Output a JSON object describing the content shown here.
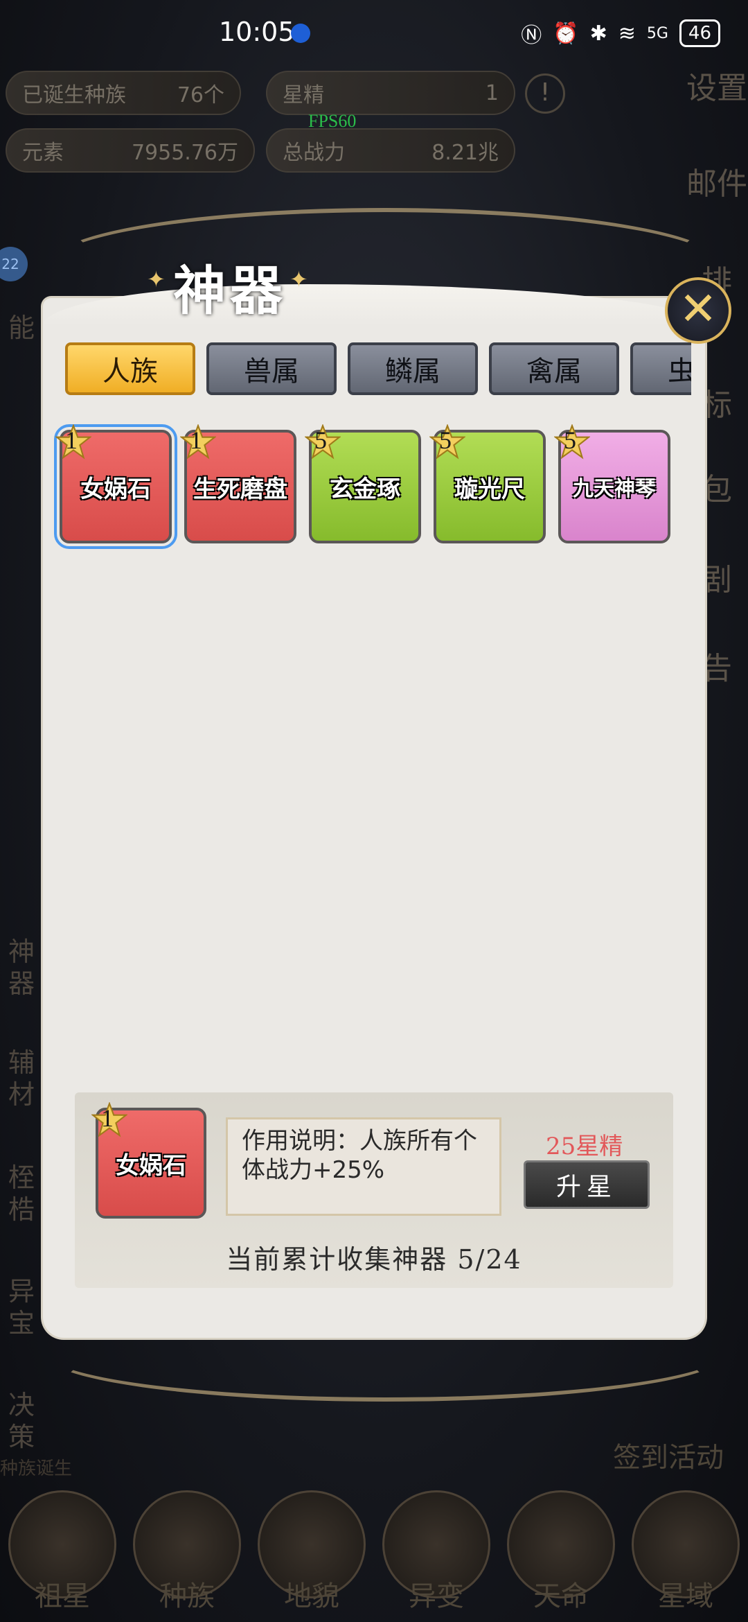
{
  "status_bar": {
    "time": "10:05",
    "battery": "46",
    "network": "5G"
  },
  "hud": {
    "races_born_label": "已诞生种族",
    "races_born_value": "76个",
    "star_essence_label": "星精",
    "star_essence_value": "1",
    "element_label": "元素",
    "element_value": "7955.76万",
    "power_label": "总战力",
    "power_value": "8.21兆",
    "fps": "FPS60"
  },
  "side_right": [
    "设置",
    "邮件",
    "排",
    "标",
    "包",
    "剧",
    "告"
  ],
  "side_left": [
    "能",
    "神器",
    "辅材",
    "桎梏",
    "异宝",
    "决策"
  ],
  "side_left_badge": "22",
  "checkin_label": "签到活动",
  "race_birth_label": "种族诞生",
  "bottom_nav": [
    "祖星",
    "种族",
    "地貌",
    "异变",
    "天命",
    "星域"
  ],
  "dialog": {
    "title": "神器",
    "tabs": [
      "人族",
      "兽属",
      "鳞属",
      "禽属",
      "虫"
    ],
    "active_tab": 0,
    "items": [
      {
        "name": "女娲石",
        "stars": "1",
        "color": "#e65f5d"
      },
      {
        "name": "生死磨盘",
        "stars": "1",
        "color": "#e65f5d"
      },
      {
        "name": "玄金琢",
        "stars": "5",
        "color": "#97cc3a"
      },
      {
        "name": "璇光尺",
        "stars": "5",
        "color": "#97cc3a"
      },
      {
        "name": "九天神琴",
        "stars": "5",
        "color": "#e49ad8"
      }
    ],
    "selected": {
      "name": "女娲石",
      "stars": "1",
      "description": "作用说明：人族所有个体战力+25%",
      "cost": "25星精",
      "upgrade_label": "升星",
      "collection_text": "当前累计收集神器  5/24"
    }
  }
}
